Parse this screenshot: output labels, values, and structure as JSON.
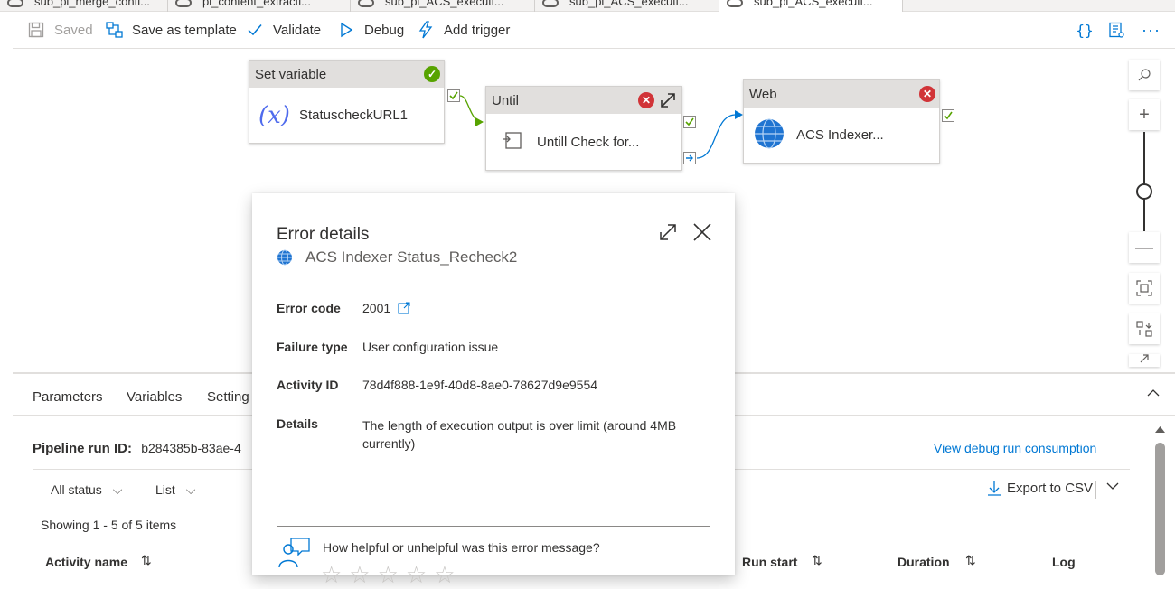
{
  "tabs": [
    {
      "label": "sub_pl_merge_conti..."
    },
    {
      "label": "pl_content_extracti..."
    },
    {
      "label": "sub_pl_ACS_executi..."
    },
    {
      "label": "sub_pl_ACS_executi..."
    },
    {
      "label": "sub_pl_ACS_executi..."
    }
  ],
  "toolbar": {
    "saved_label": "Saved",
    "save_template_label": "Save as template",
    "validate_label": "Validate",
    "debug_label": "Debug",
    "add_trigger_label": "Add trigger"
  },
  "canvas": {
    "set_variable": {
      "title": "Set variable",
      "name": "StatuscheckURL1"
    },
    "until": {
      "title": "Until",
      "name": "Untill Check for..."
    },
    "web": {
      "title": "Web",
      "name": "ACS Indexer..."
    }
  },
  "lower": {
    "tabs": [
      "Parameters",
      "Variables",
      "Setting"
    ],
    "pipeline_run_label": "Pipeline run ID:",
    "pipeline_run_value": "b284385b-83ae-4",
    "view_debug_link": "View debug run consumption",
    "filter_status": "All status",
    "filter_view": "List",
    "export_label": "Export to CSV",
    "showing": "Showing 1 - 5 of 5 items",
    "columns": {
      "activity_name": "Activity name",
      "run_start": "Run start",
      "duration": "Duration",
      "log": "Log"
    }
  },
  "error_popup": {
    "title": "Error details",
    "activity_name": "ACS Indexer Status_Recheck2",
    "fields": {
      "error_code_label": "Error code",
      "error_code_value": "2001",
      "failure_type_label": "Failure type",
      "failure_type_value": "User configuration issue",
      "activity_id_label": "Activity ID",
      "activity_id_value": "78d4f888-1e9f-40d8-8ae0-78627d9e9554",
      "details_label": "Details",
      "details_value": "The length of execution output is over limit (around 4MB currently)"
    },
    "feedback_question": "How helpful or unhelpful was this error message?"
  },
  "colors": {
    "accent": "#0078d4",
    "success": "#57a300",
    "error": "#d13438",
    "toolbar_disabled": "#a19f9d"
  }
}
